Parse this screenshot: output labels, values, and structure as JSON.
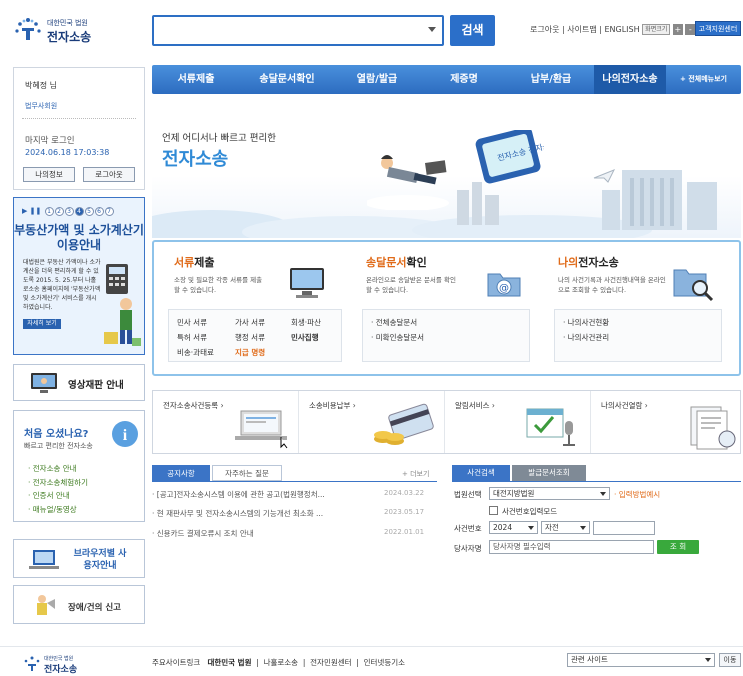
{
  "header": {
    "logo_sub": "대한민국 법원",
    "logo_main": "전자소송",
    "search_placeholder": "",
    "search_button": "검색",
    "top_links": [
      "로그아웃",
      "사이트맵",
      "ENGLISH"
    ],
    "font_size_label": "화면크기",
    "font_plus": "+",
    "font_minus": "-",
    "help_button": "고객지원센터"
  },
  "nav": {
    "items": [
      "서류제출",
      "송달문서확인",
      "열람/발급",
      "제증명",
      "납부/환급",
      "나의전자소송"
    ],
    "active": "나의전자소송",
    "all_menu": "+ 전체메뉴보기"
  },
  "user": {
    "name": "박혜정 님",
    "firm": "법무사회원",
    "last_login_label": "마지막 로그인",
    "last_login_time": "2024.06.18 17:03:38",
    "my_info_button": "나의정보",
    "logout_button": "로그아웃"
  },
  "banner": {
    "pages": [
      "1",
      "2",
      "3",
      "4",
      "5",
      "6",
      "7"
    ],
    "active_page": "4",
    "title": "부동산가액 및 소가계산기 이용안내",
    "desc": "대법원은 부동산 가액이나 소가 계산을 더욱 편리하게 할 수 있도록 2015. 5. 25.부터 나홀로소송 홈페이지에 '부동산가액 및 소가계산기' 서비스를 개시하였습니다.",
    "more": "자세히 보기"
  },
  "video": {
    "label": "영상재판 안내"
  },
  "first_visit": {
    "title": "처음 오셨나요?",
    "subtitle": "빠르고 편리한 전자소송",
    "links": [
      "전자소송 안내",
      "전자소송체험하기",
      "인증서 안내",
      "매뉴얼/동영상"
    ]
  },
  "browser_guide": {
    "label": "브라우저별 사용자안내"
  },
  "report": {
    "label": "장애/건의 신고"
  },
  "hero": {
    "line1": "언제 어디서나 빠르고 편리한",
    "line2": "전자소송",
    "scroll_text": "전자소송 전자소송"
  },
  "services": {
    "filing": {
      "title_a": "서류",
      "title_b": "제출",
      "desc": "소장 및 필요한 각종 서류를 제출할 수 있습니다.",
      "items": [
        "민사 서류",
        "가사 서류",
        "회생·파산",
        "특허 서류",
        "행정 서류",
        "민사집행",
        "비송·과태료",
        "지급 명령"
      ]
    },
    "delivery": {
      "title_a": "송달문서",
      "title_b": "확인",
      "desc": "온라인으로 송달받은 문서를 확인 할 수 있습니다.",
      "items": [
        "전체송달문서",
        "미확인송달문서"
      ]
    },
    "mine": {
      "title_a": "나의",
      "title_b": "전자소송",
      "desc": "나의 사건기록과 사건진행내역을 온라인으로 조회할 수 있습니다.",
      "items": [
        "나의사건현황",
        "나의사건관리"
      ]
    }
  },
  "cards": [
    "전자소송사건등록",
    "소송비용납부",
    "알림서비스",
    "나의사건열람"
  ],
  "notice": {
    "tabs": [
      "공지사항",
      "자주하는 질문"
    ],
    "more": "+ 더보기",
    "rows": [
      {
        "title": "[공고]전자소송시스템 이용에 관한 공고(법원행정처...",
        "date": "2024.03.22"
      },
      {
        "title": "현 재판사무 및 전자소송시스템의 기능개선 최소화 ...",
        "date": "2023.05.17"
      },
      {
        "title": "신용카드 결제오류시 조치 안내",
        "date": "2022.01.01"
      }
    ]
  },
  "case_search": {
    "tabs": [
      "사건검색",
      "발급문서조회"
    ],
    "court_label": "법원선택",
    "court_value": "대전지방법원",
    "input_method": "입력방법예시",
    "case_number_mode": "사건번호입력모드",
    "case_no_label": "사건번호",
    "year": "2024",
    "case_type": "자전",
    "party_label": "당사자명",
    "party_placeholder": "당사자명 필수입력",
    "search_button": "조 회"
  },
  "footer": {
    "logo_sub": "대한민국 법원",
    "logo_main": "전자소송",
    "links_label": "주요사이트링크",
    "links": [
      "대한민국 법원",
      "나홀로소송",
      "전자민원센터",
      "인터넷등기소"
    ],
    "related_sites": "관련 사이트",
    "go_button": "이동"
  },
  "colors": {
    "primary": "#2b6fc9",
    "nav_active": "#1e5aa8",
    "accent_orange": "#e06b1a",
    "green": "#39a93c"
  }
}
